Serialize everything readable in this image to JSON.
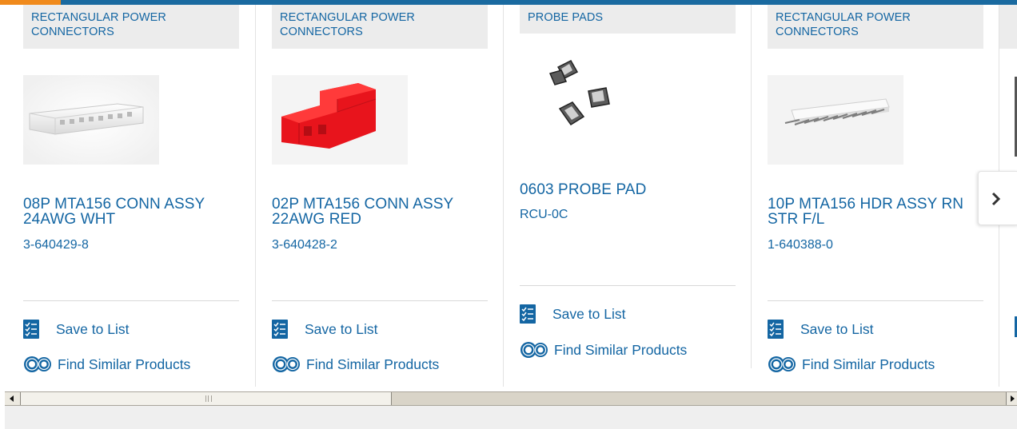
{
  "colors": {
    "brand_blue": "#1466a3",
    "accent_orange": "#f08a1c",
    "category_bg": "#ececec"
  },
  "cards": [
    {
      "category": "RECTANGULAR POWER CONNECTORS",
      "title": "08P MTA156 CONN ASSY 24AWG WHT",
      "part_number": "3-640429-8",
      "save_label": "Save to List",
      "similar_label": "Find Similar Products"
    },
    {
      "category": "RECTANGULAR POWER CONNECTORS",
      "title": "02P MTA156 CONN ASSY 22AWG RED",
      "part_number": "3-640428-2",
      "save_label": "Save to List",
      "similar_label": "Find Similar Products"
    },
    {
      "category": "PROBE PADS",
      "title": "0603 PROBE PAD",
      "part_number": "RCU-0C",
      "save_label": "Save to List",
      "similar_label": "Find Similar Products"
    },
    {
      "category": "RECTANGULAR POWER CONNECTORS",
      "title": "10P MTA156 HDR ASSY RN STR F/L",
      "part_number": "1-640388-0",
      "save_label": "Save to List",
      "similar_label": "Find Similar Products"
    }
  ],
  "icons": {
    "save": "checklist-icon",
    "similar": "gears-icon",
    "next": "chevron-right-icon"
  },
  "scrollbar": {
    "position_fraction": 0.37
  }
}
